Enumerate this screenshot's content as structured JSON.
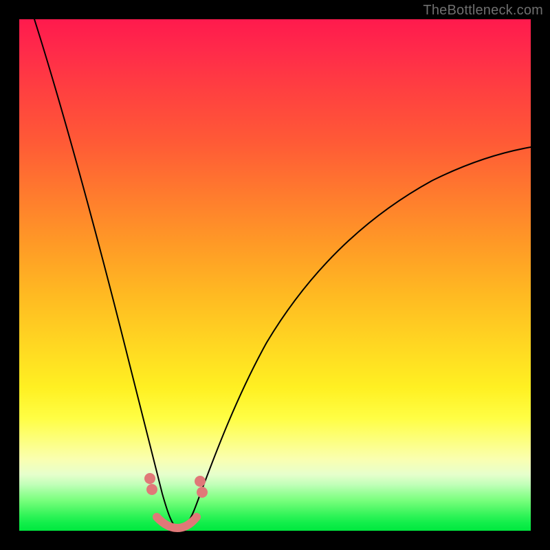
{
  "watermark": "TheBottleneck.com",
  "colors": {
    "frame": "#000000",
    "gradient_top": "#ff1a4d",
    "gradient_mid": "#fff022",
    "gradient_bottom": "#00e83f",
    "curve": "#000000",
    "markers": "#e07878"
  },
  "chart_data": {
    "type": "line",
    "title": "",
    "xlabel": "",
    "ylabel": "",
    "xlim": [
      0,
      100
    ],
    "ylim": [
      0,
      100
    ],
    "note": "Axes are unlabeled in the image; values are proportional (0–100) coordinates read off the plot area. The curve is a single V-shaped function whose minimum sits near x≈30 at the very bottom (y≈0).",
    "series": [
      {
        "name": "curve",
        "x": [
          3,
          6,
          9,
          12,
          15,
          18,
          21,
          24,
          26,
          28,
          30,
          32,
          34,
          37,
          42,
          48,
          55,
          63,
          72,
          82,
          92,
          100
        ],
        "y": [
          100,
          90,
          79,
          68,
          57,
          46,
          35,
          23,
          14,
          6,
          1,
          2,
          6,
          13,
          23,
          33,
          43,
          52,
          60,
          66,
          71,
          75
        ]
      }
    ],
    "markers": {
      "note": "Pink dots/segment near the curve basin — plotted in same 0–100 space.",
      "points": [
        {
          "x": 25.0,
          "y": 10.0
        },
        {
          "x": 25.3,
          "y": 8.0
        },
        {
          "x": 33.7,
          "y": 9.5
        },
        {
          "x": 34.0,
          "y": 7.5
        }
      ],
      "basin_segment": {
        "x0": 26.5,
        "y0": 2.2,
        "x1": 32.7,
        "y1": 2.2
      }
    }
  }
}
